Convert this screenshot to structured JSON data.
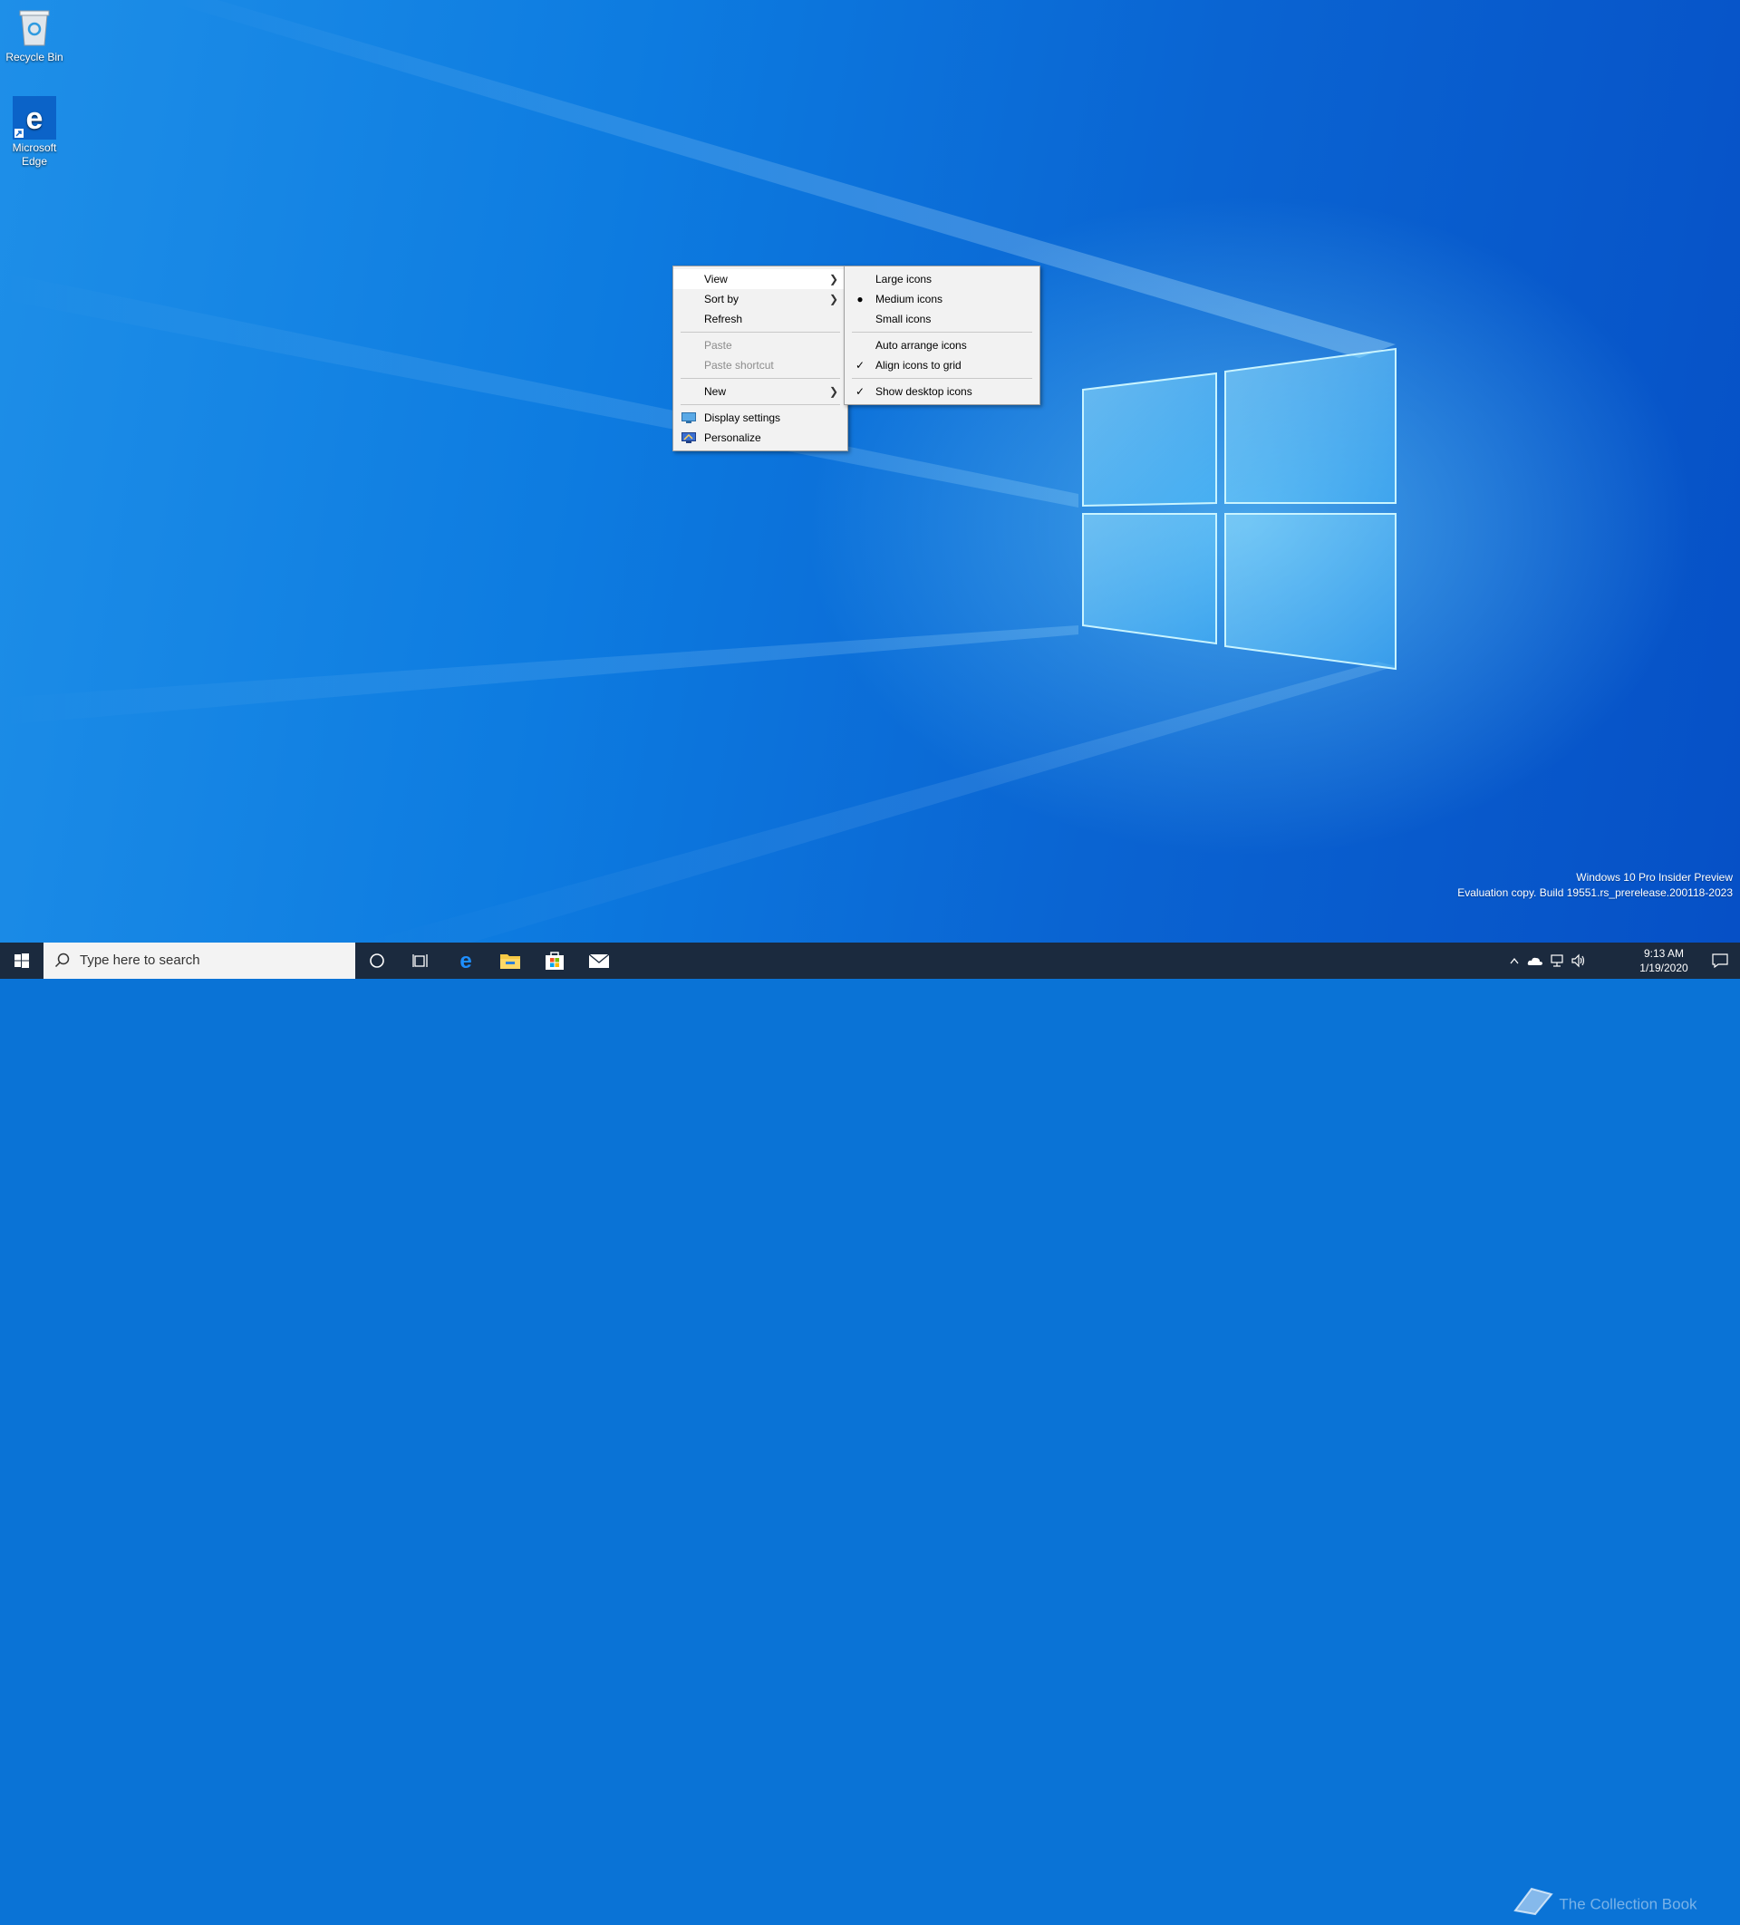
{
  "desktop": {
    "icons": [
      {
        "label": "Recycle Bin",
        "icon": "recycle-bin-icon"
      },
      {
        "label": "Microsoft Edge",
        "icon": "edge-icon"
      }
    ],
    "watermark": {
      "line1": "Windows 10 Pro Insider Preview",
      "line2": "Evaluation copy. Build 19551.rs_prerelease.200118-2023"
    },
    "collection_mark": "The Collection Book"
  },
  "context_menu": {
    "items": [
      {
        "label": "View",
        "submenu": true,
        "highlighted": true
      },
      {
        "label": "Sort by",
        "submenu": true
      },
      {
        "label": "Refresh"
      },
      {
        "label": "Paste",
        "disabled": true
      },
      {
        "label": "Paste shortcut",
        "disabled": true
      },
      {
        "label": "New",
        "submenu": true
      },
      {
        "label": "Display settings",
        "icon": "display-settings-icon"
      },
      {
        "label": "Personalize",
        "icon": "personalize-icon"
      }
    ]
  },
  "view_submenu": {
    "items": [
      {
        "label": "Large icons"
      },
      {
        "label": "Medium icons",
        "mark": "bullet"
      },
      {
        "label": "Small icons"
      },
      {
        "label": "Auto arrange icons"
      },
      {
        "label": "Align icons to grid",
        "mark": "check"
      },
      {
        "label": "Show desktop icons",
        "mark": "check"
      }
    ]
  },
  "taskbar": {
    "search_placeholder": "Type here to search",
    "pinned": [
      "cortana-icon",
      "task-view-icon",
      "edge-icon",
      "file-explorer-icon",
      "store-icon",
      "mail-icon"
    ],
    "clock": {
      "time": "9:13 AM",
      "date": "1/19/2020"
    }
  },
  "colors": {
    "taskbar": "#1b2a3e",
    "menu_bg": "#f2f2f2",
    "desktop_accent": "#0a73d6"
  }
}
